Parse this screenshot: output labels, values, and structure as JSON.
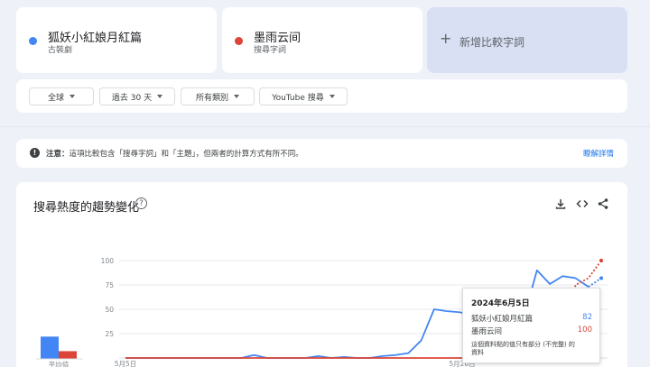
{
  "terms": [
    {
      "name": "狐妖小紅娘月紅篇",
      "type": "古裝劇",
      "color": "#4285f4"
    },
    {
      "name": "墨雨云间",
      "type": "搜尋字詞",
      "color": "#db4437"
    }
  ],
  "add_term_label": "新增比較字詞",
  "filters": {
    "region": "全球",
    "period": "過去 30 天",
    "category": "所有類別",
    "search_type": "YouTube 搜尋"
  },
  "notice": {
    "prefix": "注意：",
    "text": "這項比較包含「搜尋字詞」和「主題」，但兩者的計算方式有所不同。",
    "link": "瞭解詳情"
  },
  "chart": {
    "title": "搜尋熱度的趨勢變化",
    "average_label": "平均值",
    "tooltip": {
      "date": "2024年6月5日",
      "rows": [
        {
          "label": "狐妖小紅娘月紅篇",
          "value": "82"
        },
        {
          "label": "墨雨云间",
          "value": "100"
        }
      ],
      "note": "這個資料點的值只有部分 (不完整) 的資料"
    }
  },
  "chart_data": {
    "type": "line",
    "y_ticks": [
      "100",
      "75",
      "50",
      "25"
    ],
    "x_tick_labels": [
      "5月5日",
      "5月26日"
    ],
    "ylim": [
      0,
      100
    ],
    "averages": [
      {
        "name": "狐妖小紅娘月紅篇",
        "value": 26
      },
      {
        "name": "墨雨云间",
        "value": 9
      }
    ],
    "series": [
      {
        "name": "狐妖小紅娘月紅篇",
        "color": "#4285f4",
        "values": [
          0,
          0,
          0,
          0,
          0,
          0,
          0,
          0,
          0,
          0,
          3,
          0,
          0,
          0,
          0,
          2,
          0,
          1,
          0,
          0,
          2,
          3,
          5,
          18,
          50,
          48,
          47,
          43,
          45,
          35,
          40,
          42,
          90,
          76,
          84,
          82,
          73,
          82
        ],
        "partial_from_index": 36
      },
      {
        "name": "墨雨云间",
        "color": "#db4437",
        "values": [
          0,
          0,
          0,
          0,
          0,
          0,
          0,
          0,
          0,
          0,
          0,
          0,
          0,
          0,
          0,
          0,
          0,
          0,
          0,
          0,
          0,
          0,
          0,
          0,
          0,
          0,
          0,
          0,
          0,
          0,
          0,
          0,
          0,
          0,
          0,
          75,
          82,
          100
        ],
        "partial_from_index": 34
      }
    ]
  },
  "colors": {
    "blue": "#4285f4",
    "red": "#db4437",
    "add_card": "#d9e0f3"
  }
}
